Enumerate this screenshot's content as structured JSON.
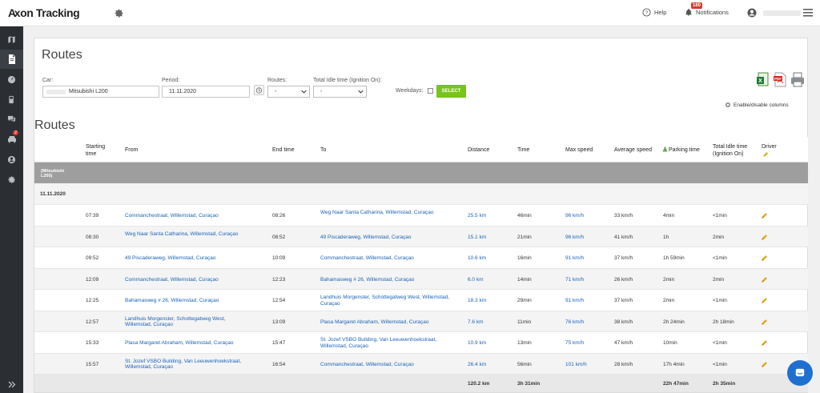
{
  "app": {
    "logo_a": "A",
    "logo_xon": "xon",
    "logo_tracking": " Tracking"
  },
  "topbar": {
    "help": "Help",
    "notifications": "Notifications",
    "notif_count": "180"
  },
  "sidebar": {
    "badge": "2"
  },
  "page": {
    "title": "Routes",
    "routes_heading": "Routes"
  },
  "filters": {
    "car_label": "Car:",
    "car_value": "Mitsubishi L200",
    "period_label": "Period:",
    "period_value": "11.11.2020",
    "routes_label": "Routes:",
    "routes_value": "-",
    "idle_label": "Total Idle time (Ignition On):",
    "idle_value": "-",
    "weekdays_label": "Weekdays:",
    "select_button": "SELECT",
    "enable_columns": "Enable/disable columns"
  },
  "table": {
    "headers": {
      "starting_time": "Starting time",
      "from": "From",
      "end_time": "End time",
      "to": "To",
      "distance": "Distance",
      "time": "Time",
      "max_speed": "Max speed",
      "avg_speed": "Average speed",
      "parking_time": "Parking time",
      "idle": "Total Idle time (Ignition On)",
      "driver": "Driver"
    },
    "group_label": "(Mitsubishi L200)",
    "date": "11.11.2020",
    "rows": [
      {
        "start": "07:39",
        "from": "Commanchestraat, Willemstad, Curaçao",
        "end": "08:26",
        "to": "Weg Naar Santa Catharina, Willemstad, Curaçao",
        "distance": "25.5 km",
        "time": "46min",
        "max_speed": "96 km/h",
        "avg_speed": "33 km/h",
        "parking": "4min",
        "idle": "<1min"
      },
      {
        "start": "08:30",
        "from": "Weg Naar Santa Catharina, Willemstad, Curaçao",
        "end": "08:52",
        "to": "49 Piscaderaweg, Willemstad, Curaçao",
        "distance": "15.1 km",
        "time": "21min",
        "max_speed": "96 km/h",
        "avg_speed": "41 km/h",
        "parking": "1h",
        "idle": "2min"
      },
      {
        "start": "09:52",
        "from": "49 Piscaderaweg, Willemstad, Curaçao",
        "end": "10:09",
        "to": "Commanchestraat, Willemstad, Curaçao",
        "distance": "10.6 km",
        "time": "16min",
        "max_speed": "91 km/h",
        "avg_speed": "37 km/h",
        "parking": "1h 59min",
        "idle": "<1min"
      },
      {
        "start": "12:09",
        "from": "Commanchestraat, Willemstad, Curaçao",
        "end": "12:23",
        "to": "Bahamasweg # 26, Willemstad, Curaçao",
        "distance": "6.0 km",
        "time": "14min",
        "max_speed": "71 km/h",
        "avg_speed": "26 km/h",
        "parking": "2min",
        "idle": "2min"
      },
      {
        "start": "12:25",
        "from": "Bahamasweg # 26, Willemstad, Curaçao",
        "end": "12:54",
        "to": "Landhuis Morgenster, Schottegatweg West, Willemstad, Curaçao",
        "distance": "18.3 km",
        "time": "29min",
        "max_speed": "91 km/h",
        "avg_speed": "37 km/h",
        "parking": "2min",
        "idle": "<1min"
      },
      {
        "start": "12:57",
        "from": "Landhuis Morgenster, Schottegatweg West, Willemstad, Curaçao",
        "end": "13:09",
        "to": "Plasa Margaret Abraham, Willemstad, Curaçao",
        "distance": "7.6 km",
        "time": "11min",
        "max_speed": "76 km/h",
        "avg_speed": "38 km/h",
        "parking": "2h 24min",
        "idle": "2h 18min"
      },
      {
        "start": "15:33",
        "from": "Plasa Margaret Abraham, Willemstad, Curaçao",
        "end": "15:47",
        "to": "St. Jozef VSBO Building, Van Leeuwenhoekstraat, Willemstad, Curaçao",
        "distance": "10.9 km",
        "time": "13min",
        "max_speed": "75 km/h",
        "avg_speed": "47 km/h",
        "parking": "10min",
        "idle": "<1min"
      },
      {
        "start": "15:57",
        "from": "St. Jozef VSBO Building, Van Leeuwenhoekstraat, Willemstad, Curaçao",
        "end": "16:54",
        "to": "Commanchestraat, Willemstad, Curaçao",
        "distance": "26.4 km",
        "time": "56min",
        "max_speed": "101 km/h",
        "avg_speed": "28 km/h",
        "parking": "17h 4min",
        "idle": "<1min"
      }
    ],
    "totals": {
      "distance": "120.2 km",
      "time": "3h 31min",
      "parking": "22h 47min",
      "idle": "2h 35min"
    }
  }
}
